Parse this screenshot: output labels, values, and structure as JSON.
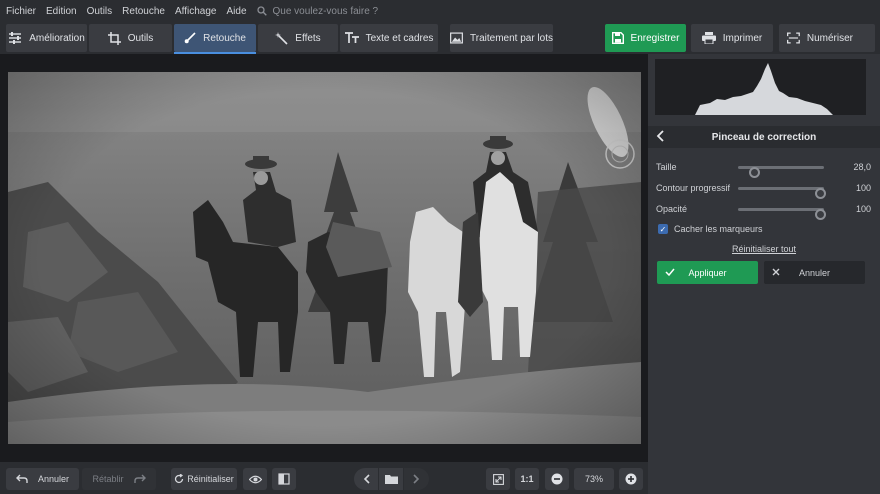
{
  "menu": {
    "items": [
      "Fichier",
      "Edition",
      "Outils",
      "Retouche",
      "Affichage",
      "Aide"
    ],
    "search_placeholder": "Que voulez-vous faire ?"
  },
  "toolbar": {
    "tabs": [
      "Amélioration",
      "Outils",
      "Retouche",
      "Effets",
      "Texte et cadres"
    ],
    "active_tab": "Retouche",
    "batch_label": "Traitement par lots",
    "save_label": "Enregistrer",
    "print_label": "Imprimer",
    "scan_label": "Numériser"
  },
  "panel": {
    "title": "Pinceau de correction",
    "size_label": "Taille",
    "size_value": "28,0",
    "size_fraction": 0.1,
    "feather_label": "Contour progressif",
    "feather_value": "100",
    "feather_fraction": 1.0,
    "opacity_label": "Opacité",
    "opacity_value": "100",
    "opacity_fraction": 1.0,
    "hide_markers_label": "Cacher les marqueurs",
    "hide_markers_checked": true,
    "reset_all_label": "Réinitialiser tout",
    "apply_label": "Appliquer",
    "cancel_label": "Annuler"
  },
  "bottombar": {
    "undo_label": "Annuler",
    "redo_label": "Rétablir",
    "reset_label": "Réinitialiser",
    "ratio_label": "1:1",
    "zoom_value": "73%"
  },
  "colors": {
    "accent_green": "#1f9a54",
    "active_tab": "#3e5575",
    "background": "#2b2d31"
  }
}
